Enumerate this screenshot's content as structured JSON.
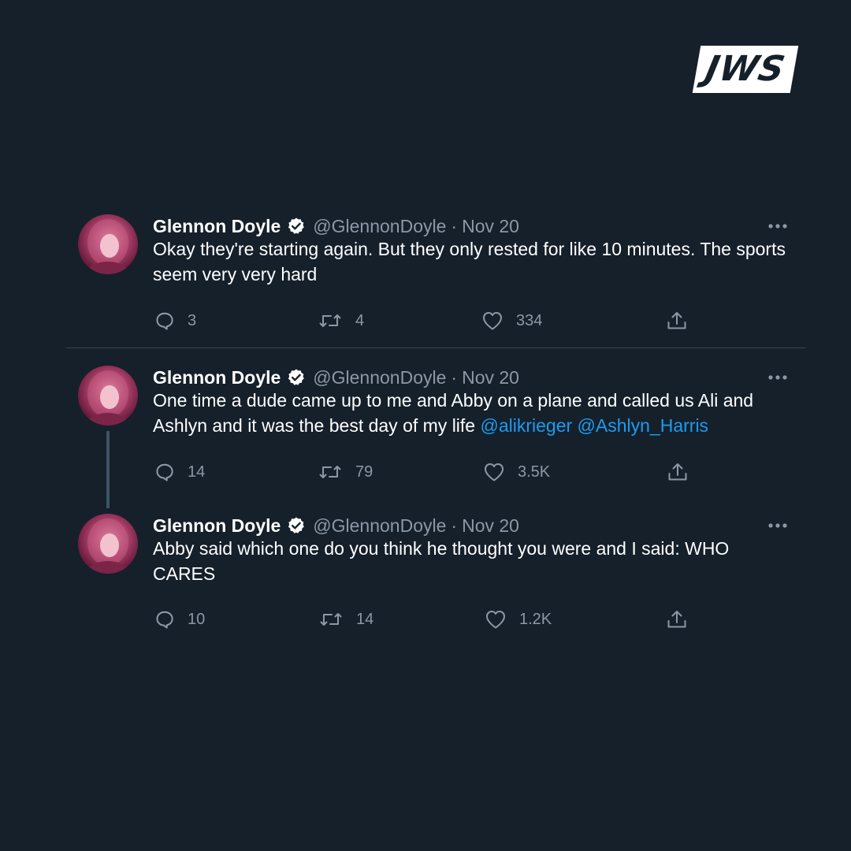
{
  "brand": {
    "badge_text": "JWS"
  },
  "tweets": [
    {
      "author": "Glennon Doyle",
      "handle": "@GlennonDoyle",
      "separator": "·",
      "date": "Nov 20",
      "text": "Okay they're starting again. But they only rested for like 10 minutes. The sports seem very very hard",
      "mentions": [],
      "replies": "3",
      "retweets": "4",
      "likes": "334"
    },
    {
      "author": "Glennon Doyle",
      "handle": "@GlennonDoyle",
      "separator": "·",
      "date": "Nov 20",
      "text": "One time a dude came up to me and Abby on a plane and called us Ali and Ashlyn and it was the best day of my life",
      "mentions": [
        "@alikrieger",
        "@Ashlyn_Harris"
      ],
      "replies": "14",
      "retweets": "79",
      "likes": "3.5K"
    },
    {
      "author": "Glennon Doyle",
      "handle": "@GlennonDoyle",
      "separator": "·",
      "date": "Nov 20",
      "text": "Abby said which one do you think he thought you were and I said: WHO CARES",
      "mentions": [],
      "replies": "10",
      "retweets": "14",
      "likes": "1.2K"
    }
  ],
  "icons": {
    "reply": "speech-bubble-icon",
    "retweet": "retweet-arrows-icon",
    "like": "heart-icon",
    "share": "share-upload-icon",
    "verified": "verified-badge-icon",
    "more": "more-dots-icon"
  },
  "colors": {
    "background": "#15202b",
    "text": "#ffffff",
    "muted": "#8b98a5",
    "link": "#1d9bf0",
    "divider": "#38444d"
  }
}
